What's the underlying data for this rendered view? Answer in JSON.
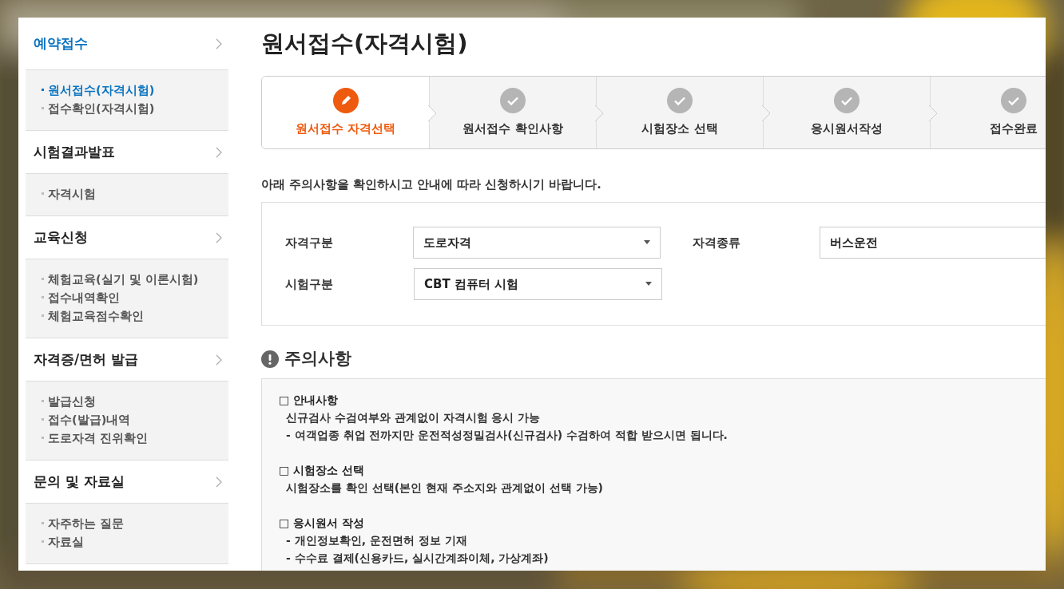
{
  "sidebar": [
    {
      "label": "예약접수",
      "selected": true,
      "items": [
        {
          "label": "원서접수(자격시험)",
          "selected": true
        },
        {
          "label": "접수확인(자격시험)",
          "selected": false
        }
      ]
    },
    {
      "label": "시험결과발표",
      "selected": false,
      "items": [
        {
          "label": "자격시험",
          "selected": false
        }
      ]
    },
    {
      "label": "교육신청",
      "selected": false,
      "items": [
        {
          "label": "체험교육(실기 및 이론시험)",
          "selected": false
        },
        {
          "label": "접수내역확인",
          "selected": false
        },
        {
          "label": "체험교육점수확인",
          "selected": false
        }
      ]
    },
    {
      "label": "자격증/면허 발급",
      "selected": false,
      "items": [
        {
          "label": "발급신청",
          "selected": false
        },
        {
          "label": "접수(발급)내역",
          "selected": false
        },
        {
          "label": "도로자격 진위확인",
          "selected": false
        }
      ]
    },
    {
      "label": "문의 및 자료실",
      "selected": false,
      "items": [
        {
          "label": "자주하는 질문",
          "selected": false
        },
        {
          "label": "자료실",
          "selected": false
        }
      ]
    }
  ],
  "page_title": "원서접수(자격시험)",
  "steps": [
    {
      "label": "원서접수 자격선택",
      "selected": true
    },
    {
      "label": "원서접수 확인사항",
      "selected": false
    },
    {
      "label": "시험장소 선택",
      "selected": false
    },
    {
      "label": "응시원서작성",
      "selected": false
    },
    {
      "label": "접수완료",
      "selected": false
    }
  ],
  "intro": "아래 주의사항을 확인하시고 안내에 따라 신청하시기 바랍니다.",
  "form": {
    "rows": [
      [
        {
          "label": "자격구분",
          "value": "도로자격"
        },
        {
          "label": "자격종류",
          "value": "버스운전"
        }
      ],
      [
        {
          "label": "시험구분",
          "value": "CBT 컴퓨터 시험"
        }
      ]
    ]
  },
  "notice": {
    "title": "주의사항",
    "sections": [
      {
        "heading": "□ 안내사항",
        "lines": [
          "신규검사 수검여부와 관계없이 자격시험 응시 가능",
          "- 여객업종 취업 전까지만 운전적성정밀검사(신규검사) 수검하여 적합 받으시면 됩니다."
        ]
      },
      {
        "heading": "□ 시험장소 선택",
        "lines": [
          "시험장소를 확인 선택(본인 현재 주소지와 관계없이 선택 가능)"
        ]
      },
      {
        "heading": "□ 응시원서 작성",
        "lines": [
          "- 개인정보확인, 운전면허 정보 기재",
          "- 수수료 결제(신용카드, 실시간계좌이체, 가상계좌)"
        ]
      }
    ]
  }
}
